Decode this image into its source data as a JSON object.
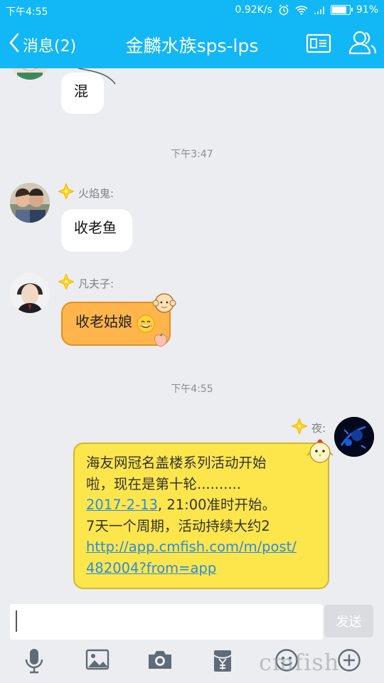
{
  "status_bar": {
    "time": "下午4:55",
    "network_speed": "0.92K/s",
    "battery": "91%",
    "battery_level": 0.91
  },
  "header": {
    "back_label": "消息(2)",
    "title": "金麟水族sps-lps",
    "icons": [
      "chevron-left-icon",
      "profile-card-icon",
      "group-members-icon"
    ]
  },
  "messages": [
    {
      "type": "text",
      "text": "混",
      "sender": ""
    },
    {
      "type": "time",
      "text": "下午3:47"
    },
    {
      "type": "text",
      "sender": "火焰鬼:",
      "text": "收老鱼"
    },
    {
      "type": "text",
      "sender": "凡夫子:",
      "text": "收老姑娘"
    },
    {
      "type": "time",
      "text": "下午4:55"
    },
    {
      "type": "text",
      "outgoing": true,
      "sender": "夜:",
      "lines": [
        "海友网冠名盖楼系列活动开始",
        "啦，现在是第十轮.........."
      ],
      "date_link": "2017-2-13",
      "after_date": ", 21:00准时开始。",
      "line4": "7天一个周期，活动持续大约2",
      "url_line1": "http://app.cmfish.com/m/post/",
      "url_line2": "482004?from=app"
    }
  ],
  "input": {
    "value": "",
    "send_label": "发送"
  },
  "toolbar": [
    "microphone-icon",
    "image-icon",
    "camera-icon",
    "red-packet-icon",
    "emoji-icon",
    "plus-icon"
  ],
  "watermark": "cmfish",
  "colors": {
    "accent": "#12b7f5",
    "link": "#2a8be2",
    "bubble_orange": "#ffb54c",
    "bubble_yellow": "#fde64b"
  }
}
